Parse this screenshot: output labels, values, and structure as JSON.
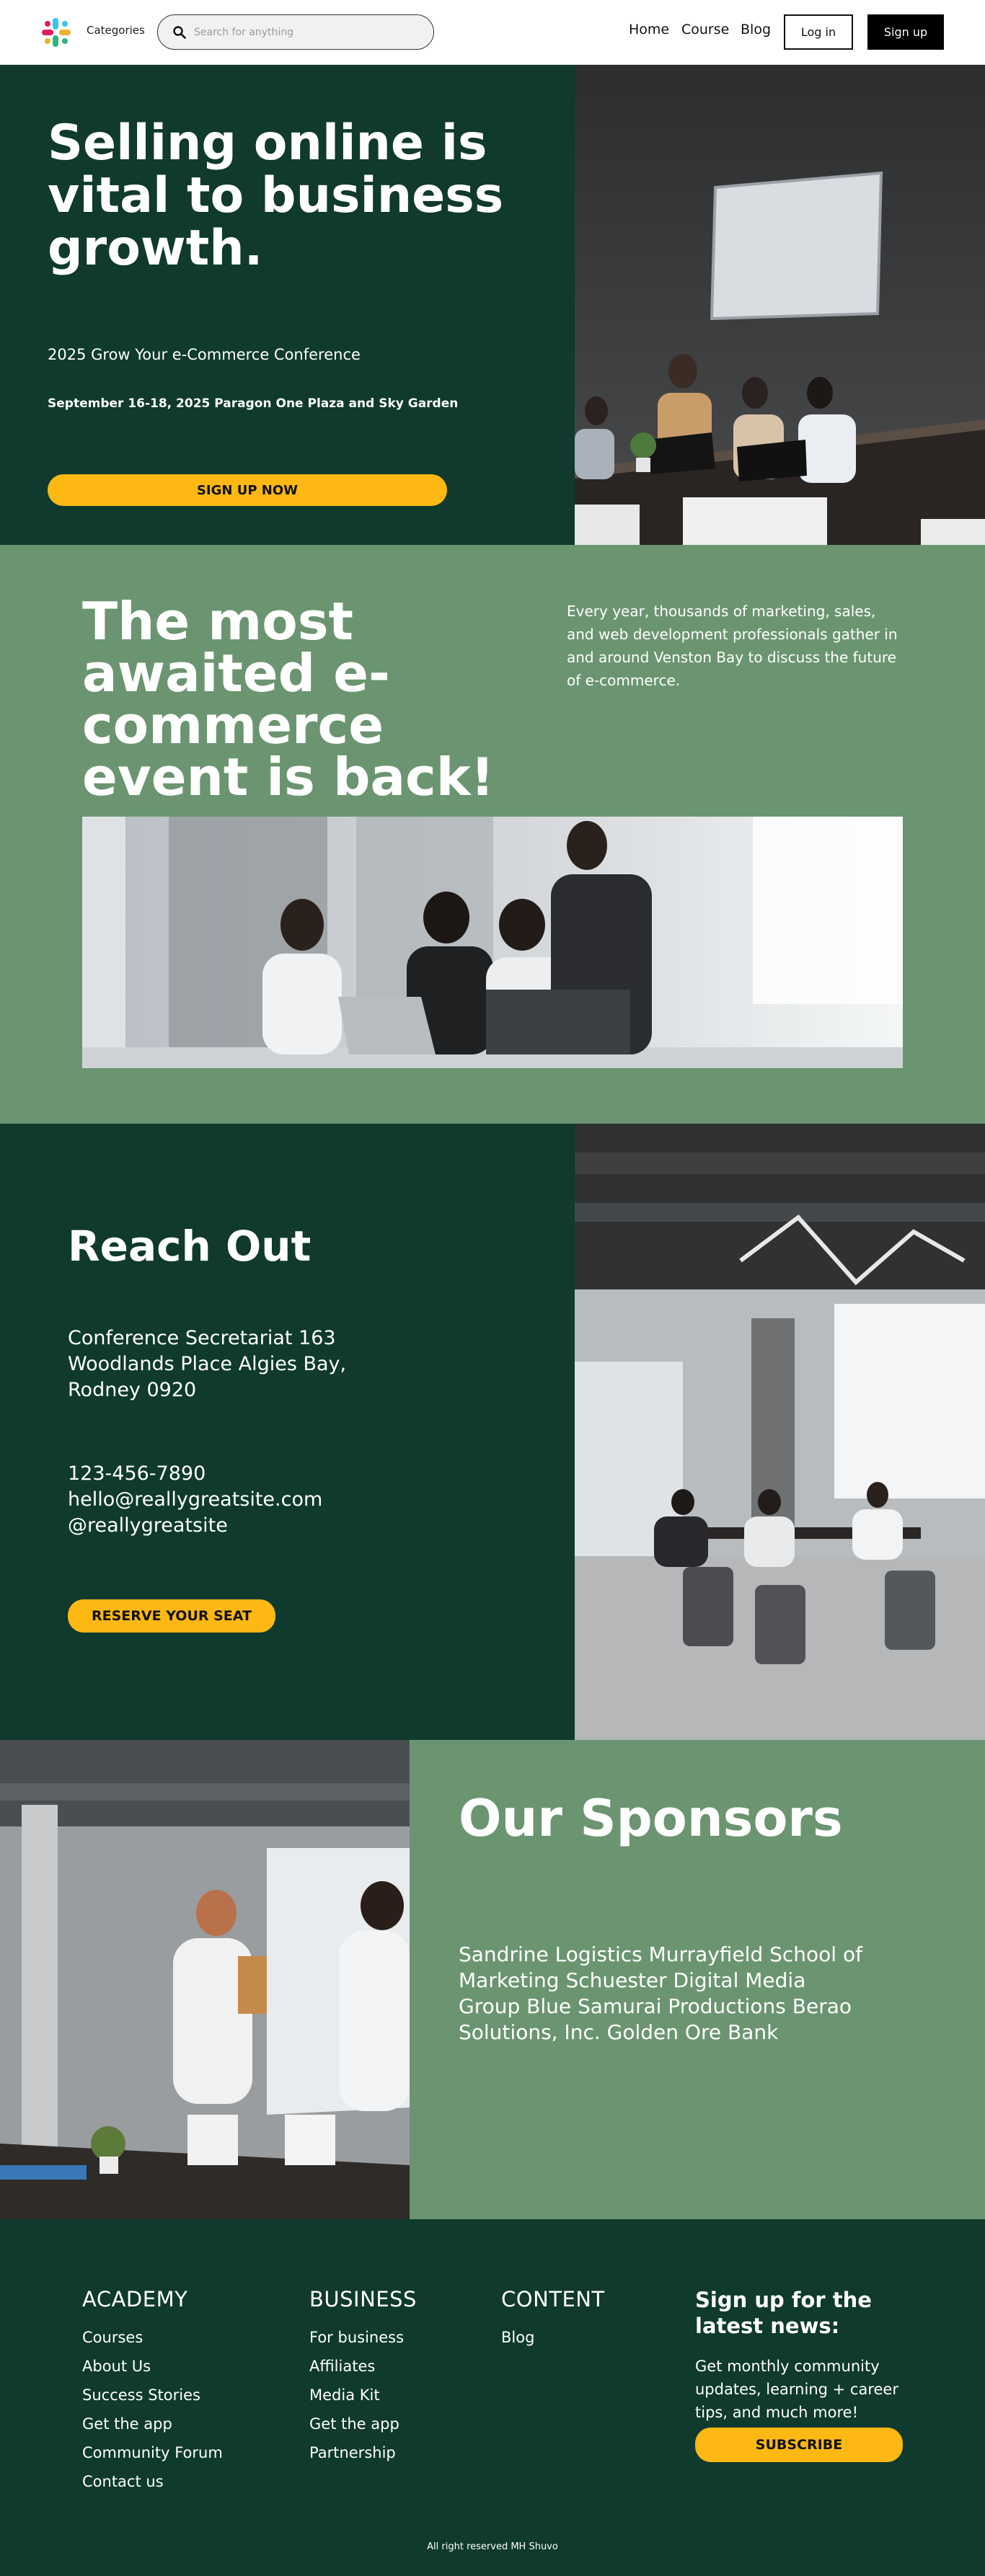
{
  "header": {
    "categories_label": "Categories",
    "search_placeholder": "Search for anything",
    "nav": [
      "Home",
      "Course",
      "Blog"
    ],
    "login_label": "Log in",
    "signup_label": "Sign up",
    "logo_icon": "slack-style-pinwheel-logo",
    "search_icon": "magnifier-icon"
  },
  "hero": {
    "title": "Selling online is vital to business growth.",
    "subtitle": "2025 Grow Your e-Commerce Conference",
    "date_venue": "September 16-18, 2025 Paragon One Plaza and Sky Garden",
    "cta_label": "SIGN UP NOW",
    "photo": "team-around-laptops-in-meeting-room"
  },
  "event": {
    "title": "The most awaited e-commerce event is back!",
    "description": "Every year, thousands of marketing, sales, and web development professionals gather in and around Venston Bay to discuss the future of e-commerce.",
    "photo": "four-colleagues-looking-at-laptops"
  },
  "reach": {
    "title": "Reach Out",
    "address": "Conference Secretariat 163 Woodlands Place Algies Bay, Rodney 0920",
    "phone": "123-456-7890",
    "email": "hello@reallygreatsite.com",
    "handle": "@reallygreatsite",
    "cta_label": "RESERVE YOUR SEAT",
    "photo": "office-meeting-at-table"
  },
  "sponsors": {
    "title": "Our Sponsors",
    "list": "Sandrine Logistics Murrayfield School of Marketing Schuester Digital Media Group Blue Samurai Productions Berao Solutions, Inc. Golden Ore Bank",
    "photo": "handshake-in-office"
  },
  "footer": {
    "academy": {
      "heading": "ACADEMY",
      "links": [
        "Courses",
        "About Us",
        "Success Stories",
        "Get the app",
        "Community Forum",
        "Contact us"
      ]
    },
    "business": {
      "heading": "BUSINESS",
      "links": [
        "For business",
        "Affiliates",
        "Media Kit",
        "Get the app",
        "Partnership"
      ]
    },
    "content": {
      "heading": "CONTENT",
      "links": [
        "Blog"
      ]
    },
    "signup": {
      "heading": "Sign up for the latest  news:",
      "text": "Get monthly community updates, learning + career tips, and much more!",
      "cta_label": "SUBSCRIBE"
    },
    "copyright": "All right reserved MH Shuvo"
  },
  "colors": {
    "dark_green": "#0f3a2d",
    "sage_green": "#6b9570",
    "accent_yellow": "#fdb813",
    "white": "#ffffff",
    "black": "#000000"
  }
}
